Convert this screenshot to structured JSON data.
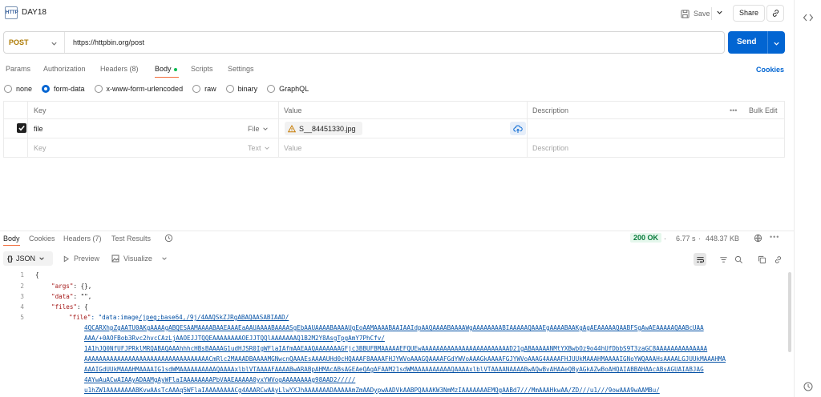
{
  "header": {
    "icon_text": "HTTP",
    "title": "DAY18",
    "save_label": "Save",
    "share_label": "Share"
  },
  "request": {
    "method": "POST",
    "url": "https://httpbin.org/post",
    "send_label": "Send"
  },
  "tabs": [
    {
      "label": "Params"
    },
    {
      "label": "Authorization"
    },
    {
      "label": "Headers (8)"
    },
    {
      "label": "Body"
    },
    {
      "label": "Scripts"
    },
    {
      "label": "Settings"
    }
  ],
  "cookies_label": "Cookies",
  "body_types": [
    {
      "label": "none",
      "selected": false
    },
    {
      "label": "form-data",
      "selected": true
    },
    {
      "label": "x-www-form-urlencoded",
      "selected": false
    },
    {
      "label": "raw",
      "selected": false
    },
    {
      "label": "binary",
      "selected": false
    },
    {
      "label": "GraphQL",
      "selected": false
    }
  ],
  "kv_table": {
    "headers": {
      "key": "Key",
      "value": "Value",
      "description": "Description",
      "bulk_edit": "Bulk Edit"
    },
    "rows": [
      {
        "key": "file",
        "type": "File",
        "value": "S__84451330.jpg",
        "description": "",
        "checked": true
      },
      {
        "key_placeholder": "Key",
        "type": "Text",
        "value_placeholder": "Value",
        "description_placeholder": "Description"
      }
    ]
  },
  "response": {
    "tabs": [
      {
        "label": "Body"
      },
      {
        "label": "Cookies"
      },
      {
        "label": "Headers (7)"
      },
      {
        "label": "Test Results"
      }
    ],
    "status": "200 OK",
    "time": "6.77 s",
    "size": "448.37 KB",
    "format": "JSON",
    "preview_label": "Preview",
    "visualize_label": "Visualize"
  },
  "code": {
    "line_numbers": [
      "1",
      "2",
      "3",
      "4",
      "5"
    ],
    "l1": "{",
    "l2_key": "\"args\"",
    "l2_rest": ": {},",
    "l3_key": "\"data\"",
    "l3_rest": ": \"\",",
    "l4_key": "\"files\"",
    "l4_rest": ": {",
    "l5_key": "\"file\"",
    "l5_mid": ": \"data:image",
    "l5_link": "/jpeg;base64,/9j/4AAQSkZJRgABAQAASABIAAD/",
    "wrapped": [
      "4QCARXhpZgAATU0AKgAAAAgABQESAAMAAAABAAEAAAEaAAUAAAABAAAASgEbAAUAAAABAAAAUgEoAAMAAAABAAIAAIdpAAQAAAABAAAAWgAAAAAAAABIAAAAAQAAAEgAAAABAAKgAgAEAAAAAQAABFSgAwAEAAAAAQAABcUAA",
      "AAA/+0AOFBob3Rvc2hvcCAzLjAAOEJJTQQEAAAAAAAAOEJJTQQlAAAAAAAQ1B2M2Y8AsgTpgAmY7PhCfv/",
      "1A1hJQ0NfUFJPRklMRQABAQAAAhhhcHBsBAAAAG1udHJSR0IgWFlaIAfmAAEAAQAAAAAAAGFjc3BBUFBMAAAAAEFQUEwAAAAAAAAAAAAAAAAAAAAAAAAD21gABAAAAANMtYXBwbOz9o44hUfDbbS9T3zaGC8AAAAAAAAAAAAAA",
      "AAAAAAAAAAAAAAAAAAAAAAAAAAAAAAAAAACmRlc2MAAADBAAAAMGNwcnQAAAEsAAAAUHd0cHQAAAF8AAAAFHJYWVoAAAGQAAAAFGdYWVoAAAGkAAAAFGJYWVoAAAG4AAAAFHJUUkMAAAHMAAAAIGNoYWQAAAHsAAAALGJUUkMAAAHMA",
      "AAAIGdUUkMAAAHMAAAAIG1sdWMAAAAAAAAAAQAAAAxlblVTAAAAFAAAABwARABpAHMAcABsAGEAeQAgAFAAM21sdWMAAAAAAAAAAQAAAAxlblVTAAAANAAAABwAQwBvAHAAeQByAGkAZwBoAHQAIABBAHAAcABsAGUAIABJAG",
      "4AYwAuACwAIAAyADAAMgAyWFlaIAAAAAAAAPbVAAEAAAAA0yxYWVogAAAAAAAAg98AAD2/////",
      "u1hZW1AAAAAAAABKvwAAsTcAAAq5WFlaIAAAAAAAACg4AAARCwAAyLlwYXJhAAAAAAADAAAAAmZmAADypwAADVkAABPQAAAKW3NmMzIAAAAAAAEMQgAABd7///MmAAAHkwAA/ZD///u1///9owAAA9wAAMBu/"
    ]
  }
}
